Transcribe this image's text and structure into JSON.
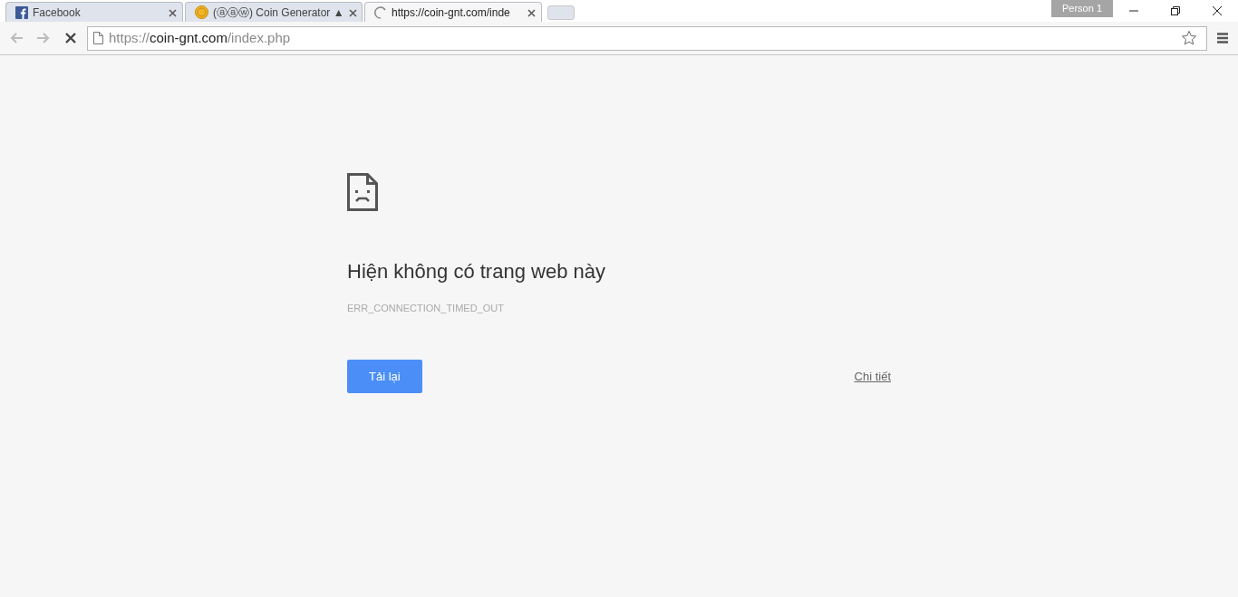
{
  "tabs": [
    {
      "kind": "facebook",
      "title": "Facebook",
      "selected": false
    },
    {
      "kind": "coin",
      "title": "(ⓐⓐⓦ) Coin Generator ▲",
      "selected": false
    },
    {
      "kind": "loading",
      "title": "https://coin-gnt.com/inde",
      "selected": true
    }
  ],
  "profile": "Person 1",
  "address_bar": {
    "scheme": "https://",
    "host": "coin-gnt.com",
    "path": "/index.php"
  },
  "error_page": {
    "title": "Hiện không có trang web này",
    "code": "ERR_CONNECTION_TIMED_OUT",
    "reload_button": "Tải lại",
    "details_link": "Chi tiết"
  }
}
